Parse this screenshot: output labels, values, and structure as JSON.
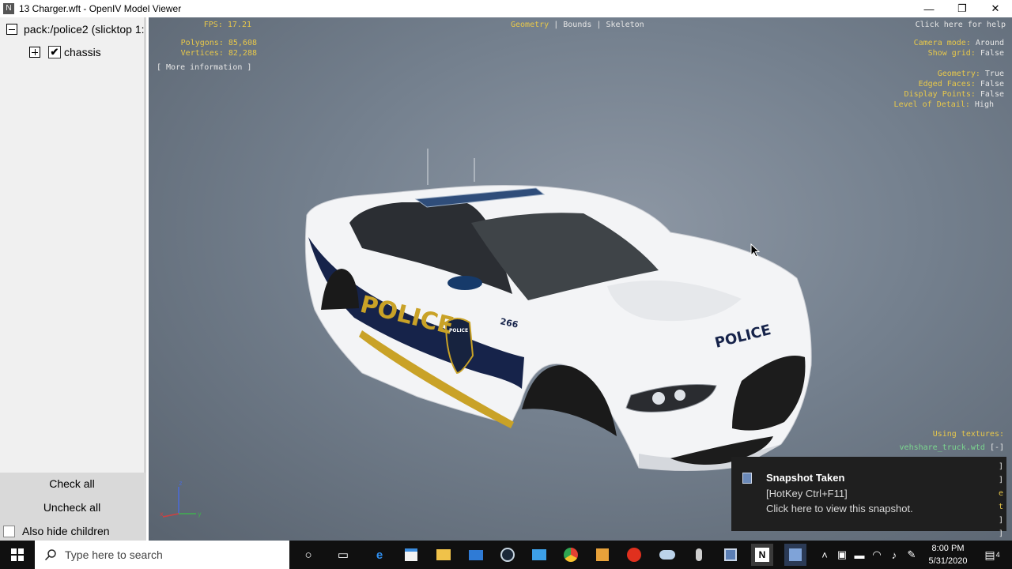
{
  "window": {
    "app_icon": "oiv-icon",
    "title": "13 Charger.wft - OpenIV Model Viewer",
    "minimize": "—",
    "maximize": "❐",
    "close": "✕"
  },
  "tree": {
    "root_label": "pack:/police2 (slicktop 1:",
    "child_label": "chassis",
    "child_checked": "✔"
  },
  "panel": {
    "check_all": "Check all",
    "uncheck_all": "Uncheck all",
    "also_hide_children": "Also hide children"
  },
  "overlay": {
    "fps_label": "FPS:",
    "fps_value": "17.21",
    "polygons_label": "Polygons:",
    "polygons_value": "85,608",
    "vertices_label": "Vertices:",
    "vertices_value": "82,288",
    "more_info": "[ More information ]",
    "mode_geometry": "Geometry",
    "mode_sep1": "|",
    "mode_bounds": "Bounds",
    "mode_sep2": "|",
    "mode_skeleton": "Skeleton",
    "help": "Click here for help",
    "camera_label": "Camera mode:",
    "camera_value": "Around",
    "grid_label": "Show grid:",
    "grid_value": "False",
    "geometry_label": "Geometry:",
    "geometry_value": "True",
    "edged_label": "Edged Faces:",
    "edged_value": "False",
    "points_label": "Display Points:",
    "points_value": "False",
    "lod_label": "Level of Detail:",
    "lod_value": "High",
    "textures_label": "Using textures:",
    "texture_file": "vehshare_truck.wtd",
    "texture_toggle": "[-]",
    "axis_z": "z",
    "axis_x": "x",
    "axis_y": "y"
  },
  "vehicle": {
    "side_text": "POLICE",
    "hood_text": "POLICE",
    "unit_number": "266",
    "badge_text": "POLICE"
  },
  "toast": {
    "title": "Snapshot Taken",
    "line1": "[HotKey Ctrl+F11]",
    "line2": "Click here to view this snapshot.",
    "edge_chars": [
      "]",
      "]",
      "e",
      "t",
      "]",
      "]"
    ]
  },
  "taskbar": {
    "search_placeholder": "Type here to search",
    "time": "8:00 PM",
    "date": "5/31/2020",
    "notif_count": "4"
  },
  "colors": {
    "overlay_key": "#e8c84a",
    "overlay_value": "#e6e6e6",
    "texture_link": "#7bd88f",
    "police_blue": "#16234a",
    "police_gold": "#c9a227"
  }
}
